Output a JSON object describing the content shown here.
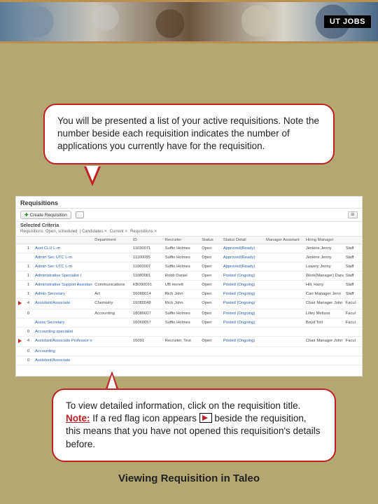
{
  "banner": {
    "logo": "UT JOBS"
  },
  "callouts": {
    "top": "You will be presented a list of your active requisitions. Note the number beside each requisition indicates the number of applications you currently have for the requisition.",
    "bottom_pre": "To view detailed information, click on the requisition title. ",
    "bottom_note_label": "Note:",
    "bottom_mid": " If a red flag icon appears ",
    "bottom_post": " beside the requisition, this means that you have not opened this requisition's details before."
  },
  "screenshot": {
    "panel_title": "Requisitions",
    "create_label": "Create Requisition",
    "criteria_title": "Selected Criteria",
    "criteria_text": "Requisitions: Open, scheduled",
    "criteria_chip_label": "Candidates",
    "criteria_chip2": "Current",
    "criteria_chip3": "Requisitions",
    "columns": [
      "",
      "",
      "",
      "Department",
      "ID",
      "Recruiter",
      "Status",
      "Status Detail",
      "Manager Assistant",
      "Hiring Manager",
      ""
    ],
    "rows": [
      {
        "flag": false,
        "count": "1",
        "title": "Asst CLU L-m",
        "dept": "",
        "id": "11030071",
        "recruiter": "Suffin Holmes",
        "status": "Open",
        "detail": "Approved(Ready)",
        "mgrA": "",
        "mgrB": "Jenkins Jenny",
        "role": "Staff"
      },
      {
        "flag": false,
        "count": "",
        "title": "Admin Sec UTC L-m",
        "dept": "",
        "id": "11100085",
        "recruiter": "Suffin Holmes",
        "status": "Open",
        "detail": "Approved(Ready)",
        "mgrA": "",
        "mgrB": "Jenkins Jenny",
        "role": "Staff"
      },
      {
        "flag": false,
        "count": "1",
        "title": "Admin Sec UTC L-m",
        "dept": "",
        "id": "11060007",
        "recruiter": "Suffin Holmes",
        "status": "Open",
        "detail": "Approved(Ready)",
        "mgrA": "",
        "mgrB": "Lowery Jenny",
        "role": "Staff"
      },
      {
        "flag": false,
        "count": "1",
        "title": "Administrative Specialist I",
        "dept": "",
        "id": "11080081",
        "recruiter": "Robb Daniel",
        "status": "Open",
        "detail": "Posted (Ongoing)",
        "mgrA": "",
        "mgrB": "Work(Manager) Dana",
        "role": "Staff"
      },
      {
        "flag": false,
        "count": "1",
        "title": "Administrative Support Assistant III",
        "dept": "Communications",
        "id": "KB090091",
        "recruiter": "UB morett",
        "status": "Open",
        "detail": "Posted (Ongoing)",
        "mgrA": "",
        "mgrB": "Hill, Harry",
        "role": "Staff"
      },
      {
        "flag": false,
        "count": "1",
        "title": "Admin Secretary",
        "dept": "Art",
        "id": "16080014",
        "recruiter": "Rich John",
        "status": "Open",
        "detail": "Posted (Ongoing)",
        "mgrA": "",
        "mgrB": "Carr Manager Jenn",
        "role": "Staff"
      },
      {
        "flag": true,
        "count": "4",
        "title": "Assistant/Associate",
        "dept": "Chemistry",
        "id": "16080048",
        "recruiter": "Rich John",
        "status": "Open",
        "detail": "Posted (Ongoing)",
        "mgrA": "",
        "mgrB": "Chair Manager John",
        "role": "Facul"
      },
      {
        "flag": false,
        "count": "0",
        "title": "",
        "dept": "Accounting",
        "id": "18080007",
        "recruiter": "Suffin Holmes",
        "status": "Open",
        "detail": "Posted (Ongoing)",
        "mgrA": "",
        "mgrB": "Lilley Melissa",
        "role": "Facul"
      },
      {
        "flag": false,
        "count": "",
        "title": "Assoc Secretary",
        "dept": "",
        "id": "16060057",
        "recruiter": "Suffin Holmes",
        "status": "Open",
        "detail": "Posted (Ongoing)",
        "mgrA": "",
        "mgrB": "Boyd Tori",
        "role": "Facul"
      },
      {
        "flag": false,
        "count": "0",
        "title": "Accounting specialist",
        "dept": "",
        "id": "",
        "recruiter": "",
        "status": "",
        "detail": "",
        "mgrA": "",
        "mgrB": "",
        "role": ""
      },
      {
        "flag": true,
        "count": "4",
        "title": "Assistant/Associate Professor of Accounting - K s",
        "dept": "",
        "id": "16091",
        "recruiter": "Recruiter, Test",
        "status": "Open",
        "detail": "Posted (Ongoing)",
        "mgrA": "",
        "mgrB": "Chair Manager John",
        "role": "Facul"
      },
      {
        "flag": false,
        "count": "0",
        "title": "Accounting",
        "dept": "",
        "id": "",
        "recruiter": "",
        "status": "",
        "detail": "",
        "mgrA": "",
        "mgrB": "",
        "role": ""
      },
      {
        "flag": false,
        "count": "0",
        "title": "Assistant/Associate",
        "dept": "",
        "id": "",
        "recruiter": "",
        "status": "",
        "detail": "",
        "mgrA": "",
        "mgrB": "",
        "role": ""
      }
    ]
  },
  "footer": "Viewing Requisition in Taleo"
}
